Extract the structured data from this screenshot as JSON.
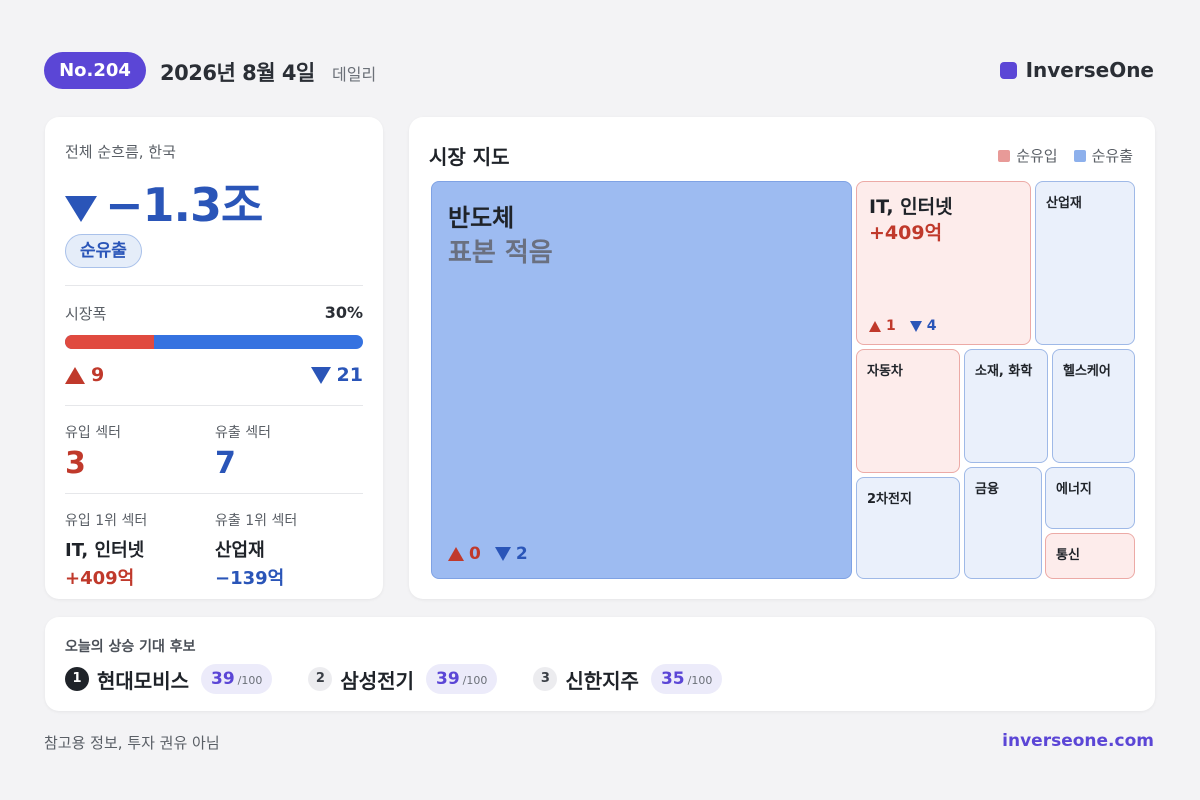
{
  "header": {
    "issue_badge": "No.204",
    "date": "2026년 8월 4일",
    "frequency": "데일리",
    "brand": "InverseOne",
    "brand_color": "#5b46d6"
  },
  "summary": {
    "flow_label": "전체 순흐름, 한국",
    "flow_value": "−1.3조",
    "flow_direction_icon": "triangle-down-icon",
    "flow_status": "순유출",
    "breadth_label": "시장폭",
    "breadth_pct": "30%",
    "breadth_fraction": 0.3,
    "advancers": "9",
    "decliners": "21",
    "inflow_sectors_label": "유입 섹터",
    "inflow_sectors": "3",
    "outflow_sectors_label": "유출 섹터",
    "outflow_sectors": "7",
    "top_inflow_label": "유입 1위 섹터",
    "top_inflow_name": "IT, 인터넷",
    "top_inflow_value": "+409억",
    "top_outflow_label": "유출 1위 섹터",
    "top_outflow_name": "산업재",
    "top_outflow_value": "−139억"
  },
  "market_map": {
    "title": "시장 지도",
    "legend": [
      {
        "label": "순유입",
        "color": "#e89a98"
      },
      {
        "label": "순유출",
        "color": "#8db0ec"
      }
    ],
    "tiles": {
      "semiconductor": {
        "name": "반도체",
        "note": "표본 적음",
        "up": "0",
        "down": "2"
      },
      "it_internet": {
        "name": "IT, 인터넷",
        "amount": "+409억",
        "up": "1",
        "down": "4"
      },
      "industrials": {
        "name": "산업재"
      },
      "auto": {
        "name": "자동차"
      },
      "materials": {
        "name": "소재, 화학"
      },
      "healthcare": {
        "name": "헬스케어"
      },
      "battery": {
        "name": "2차전지"
      },
      "finance": {
        "name": "금융"
      },
      "energy": {
        "name": "에너지"
      },
      "telecom": {
        "name": "통신"
      }
    }
  },
  "candidates": {
    "title": "오늘의 상승 기대 후보",
    "items": [
      {
        "rank": "1",
        "name": "현대모비스",
        "score": "39",
        "max": "/100"
      },
      {
        "rank": "2",
        "name": "삼성전기",
        "score": "39",
        "max": "/100"
      },
      {
        "rank": "3",
        "name": "신한지주",
        "score": "35",
        "max": "/100"
      }
    ]
  },
  "footer": {
    "disclaimer": "참고용 정보, 투자 권유 아님",
    "site": "inverseone.com"
  }
}
